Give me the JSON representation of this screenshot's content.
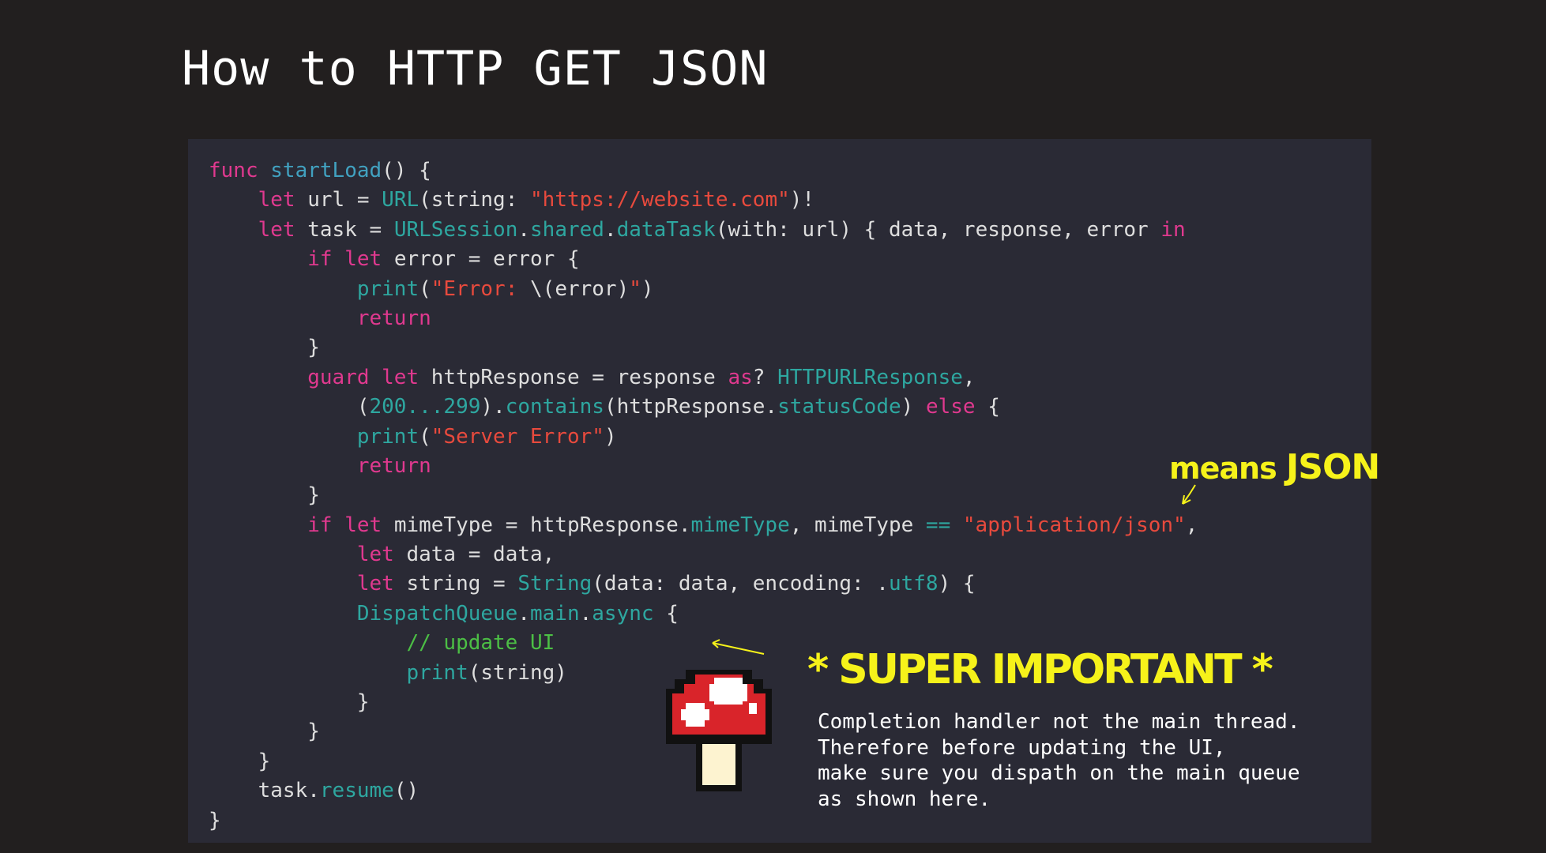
{
  "title": "How to HTTP GET JSON",
  "code_lines": [
    {
      "indent": 0,
      "tokens": [
        [
          "kw",
          "func "
        ],
        [
          "fn",
          "startLoad"
        ],
        [
          "pl",
          "() {"
        ]
      ]
    },
    {
      "indent": 1,
      "tokens": [
        [
          "kw",
          "let "
        ],
        [
          "pl",
          "url = "
        ],
        [
          "ty",
          "URL"
        ],
        [
          "pl",
          "(string: "
        ],
        [
          "st",
          "\"https://website.com\""
        ],
        [
          "pl",
          ")!"
        ]
      ]
    },
    {
      "indent": 1,
      "tokens": [
        [
          "kw",
          "let "
        ],
        [
          "pl",
          "task = "
        ],
        [
          "ty",
          "URLSession"
        ],
        [
          "pl",
          "."
        ],
        [
          "ty",
          "shared"
        ],
        [
          "pl",
          "."
        ],
        [
          "ty",
          "dataTask"
        ],
        [
          "pl",
          "(with: url) { data, response, error "
        ],
        [
          "kw",
          "in"
        ]
      ]
    },
    {
      "indent": 2,
      "tokens": [
        [
          "kw",
          "if let "
        ],
        [
          "pl",
          "error = error {"
        ]
      ]
    },
    {
      "indent": 3,
      "tokens": [
        [
          "ty",
          "print"
        ],
        [
          "pl",
          "("
        ],
        [
          "st",
          "\"Error: "
        ],
        [
          "pl",
          "\\(error)"
        ],
        [
          "st",
          "\""
        ],
        [
          "pl",
          ")"
        ]
      ]
    },
    {
      "indent": 3,
      "tokens": [
        [
          "kw",
          "return"
        ]
      ]
    },
    {
      "indent": 2,
      "tokens": [
        [
          "pl",
          "}"
        ]
      ]
    },
    {
      "indent": 2,
      "tokens": [
        [
          "kw",
          "guard let "
        ],
        [
          "pl",
          "httpResponse = response "
        ],
        [
          "kw",
          "as"
        ],
        [
          "pl",
          "? "
        ],
        [
          "ty",
          "HTTPURLResponse"
        ],
        [
          "pl",
          ","
        ]
      ]
    },
    {
      "indent": 3,
      "tokens": [
        [
          "pl",
          "("
        ],
        [
          "ty",
          "200...299"
        ],
        [
          "pl",
          ")."
        ],
        [
          "ty",
          "contains"
        ],
        [
          "pl",
          "(httpResponse."
        ],
        [
          "ty",
          "statusCode"
        ],
        [
          "pl",
          ") "
        ],
        [
          "kw",
          "else"
        ],
        [
          "pl",
          " {"
        ]
      ]
    },
    {
      "indent": 3,
      "tokens": [
        [
          "ty",
          "print"
        ],
        [
          "pl",
          "("
        ],
        [
          "st",
          "\"Server Error\""
        ],
        [
          "pl",
          ")"
        ]
      ]
    },
    {
      "indent": 3,
      "tokens": [
        [
          "kw",
          "return"
        ]
      ]
    },
    {
      "indent": 2,
      "tokens": [
        [
          "pl",
          "}"
        ]
      ]
    },
    {
      "indent": 2,
      "tokens": [
        [
          "kw",
          "if let "
        ],
        [
          "pl",
          "mimeType = httpResponse."
        ],
        [
          "ty",
          "mimeType"
        ],
        [
          "pl",
          ", mimeType "
        ],
        [
          "ty",
          "=="
        ],
        [
          "pl",
          " "
        ],
        [
          "st",
          "\"application/json\""
        ],
        [
          "pl",
          ","
        ]
      ]
    },
    {
      "indent": 3,
      "tokens": [
        [
          "kw",
          "let "
        ],
        [
          "pl",
          "data = data,"
        ]
      ]
    },
    {
      "indent": 3,
      "tokens": [
        [
          "kw",
          "let "
        ],
        [
          "pl",
          "string = "
        ],
        [
          "ty",
          "String"
        ],
        [
          "pl",
          "(data: data, encoding: ."
        ],
        [
          "ty",
          "utf8"
        ],
        [
          "pl",
          ") {"
        ]
      ]
    },
    {
      "indent": 3,
      "tokens": [
        [
          "ty",
          "DispatchQueue"
        ],
        [
          "pl",
          "."
        ],
        [
          "ty",
          "main"
        ],
        [
          "pl",
          "."
        ],
        [
          "ty",
          "async"
        ],
        [
          "pl",
          " {"
        ]
      ]
    },
    {
      "indent": 4,
      "tokens": [
        [
          "cm",
          "// update UI"
        ]
      ]
    },
    {
      "indent": 4,
      "tokens": [
        [
          "ty",
          "print"
        ],
        [
          "pl",
          "(string)"
        ]
      ]
    },
    {
      "indent": 3,
      "tokens": [
        [
          "pl",
          "}"
        ]
      ]
    },
    {
      "indent": 2,
      "tokens": [
        [
          "pl",
          "}"
        ]
      ]
    },
    {
      "indent": 1,
      "tokens": [
        [
          "pl",
          "}"
        ]
      ]
    },
    {
      "indent": 1,
      "tokens": [
        [
          "pl",
          "task."
        ],
        [
          "ty",
          "resume"
        ],
        [
          "pl",
          "()"
        ]
      ]
    },
    {
      "indent": 0,
      "tokens": [
        [
          "pl",
          "}"
        ]
      ]
    }
  ],
  "annotations": {
    "means_word": "means ",
    "json_word": "JSON",
    "super_important": "* SUPER IMPORTANT *",
    "completion_lines": [
      "Completion handler not the main thread.",
      "Therefore before updating the UI,",
      "make sure you dispath on the main queue",
      "as shown here."
    ]
  },
  "colors": {
    "background": "#221f1f",
    "code_panel": "#2a2a35",
    "keyword": "#e0398f",
    "function": "#41a1c0",
    "type": "#2ea7a0",
    "string": "#e84a3d",
    "comment": "#4cbf45",
    "plain": "#dedede",
    "annotation": "#f6f21a",
    "mushroom_red": "#d9242a",
    "mushroom_stem": "#fdf3d0"
  },
  "icons": {
    "mushroom": "pixel-mushroom-icon",
    "arrow_json": "arrow-down-left-icon",
    "arrow_ui": "arrow-left-icon"
  }
}
